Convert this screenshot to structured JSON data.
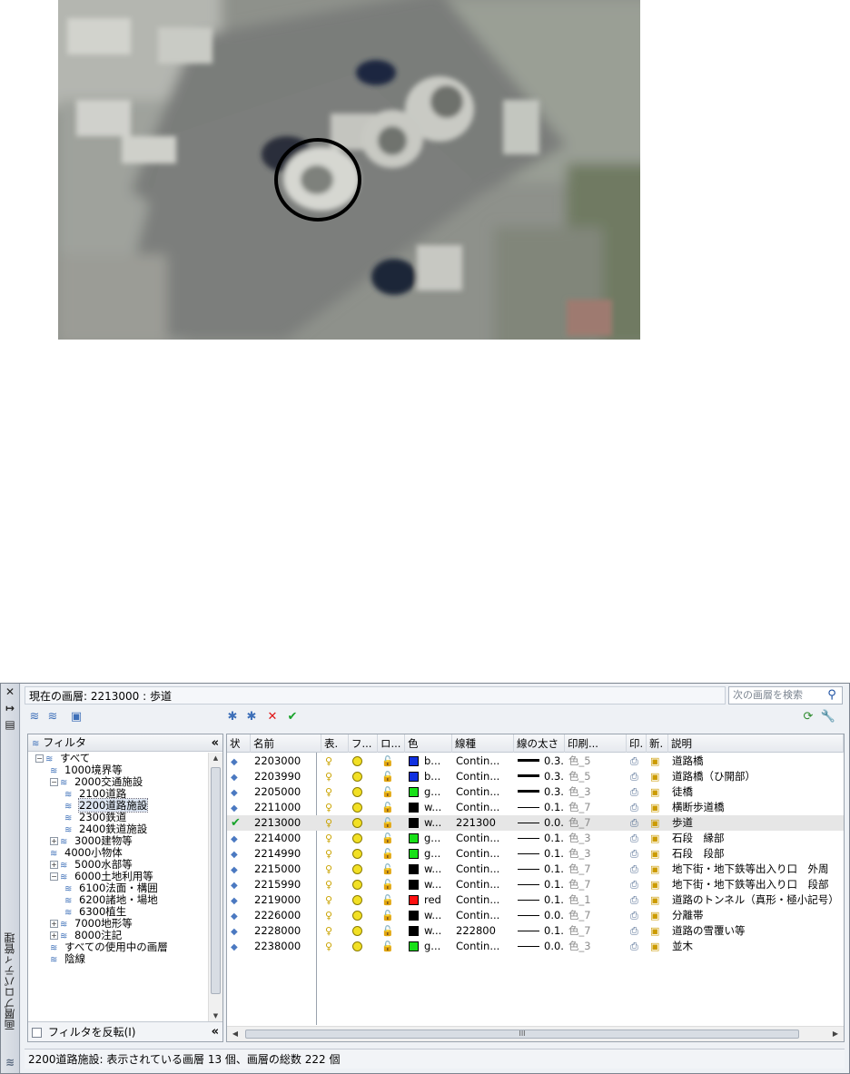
{
  "palette": {
    "title": "画層プロパティ管理",
    "current_layer": "現在の画層: 2213000 : 歩道",
    "search_placeholder": "次の画層を検索",
    "colors": {
      "accent": "#1b4fa2",
      "status_check": "#18a32a"
    }
  },
  "tree": {
    "header": "フィルタ",
    "collapse_label": "«",
    "nodes": [
      {
        "label": "すべて",
        "expander": "−"
      },
      {
        "label": "1000境界等",
        "expander": ""
      },
      {
        "label": "2000交通施設",
        "expander": "−"
      },
      {
        "label": "2100道路",
        "expander": ""
      },
      {
        "label": "2200道路施設",
        "expander": "",
        "selected": true
      },
      {
        "label": "2300鉄道",
        "expander": ""
      },
      {
        "label": "2400鉄道施設",
        "expander": ""
      },
      {
        "label": "3000建物等",
        "expander": "+"
      },
      {
        "label": "4000小物体",
        "expander": ""
      },
      {
        "label": "5000水部等",
        "expander": "+"
      },
      {
        "label": "6000土地利用等",
        "expander": "−"
      },
      {
        "label": "6100法面・構囲",
        "expander": ""
      },
      {
        "label": "6200諸地・場地",
        "expander": ""
      },
      {
        "label": "6300植生",
        "expander": ""
      },
      {
        "label": "7000地形等",
        "expander": "+"
      },
      {
        "label": "8000注記",
        "expander": "+"
      },
      {
        "label": "すべての使用中の画層",
        "expander": ""
      },
      {
        "label": "陰線",
        "expander": ""
      }
    ],
    "invert_filter_label": "フィルタを反転(I)"
  },
  "grid": {
    "columns": [
      "状",
      "名前",
      "表.",
      "フ...",
      "ロ...",
      "色",
      "線種",
      "線の太さ",
      "印刷...",
      "印.",
      "新.",
      "説明"
    ],
    "rows": [
      {
        "status": "layer",
        "name": "2203000",
        "color_name": "b...",
        "color_hex": "#1030e0",
        "linetype": "Contin...",
        "lineweight": "0.3...",
        "lw_heavy": true,
        "plot_style": "色_5",
        "description": "道路橋"
      },
      {
        "status": "layer",
        "name": "2203990",
        "color_name": "b...",
        "color_hex": "#1030e0",
        "linetype": "Contin...",
        "lineweight": "0.3...",
        "lw_heavy": true,
        "plot_style": "色_5",
        "description": "道路橋（ひ開部）"
      },
      {
        "status": "layer",
        "name": "2205000",
        "color_name": "g...",
        "color_hex": "#18e018",
        "linetype": "Contin...",
        "lineweight": "0.3...",
        "lw_heavy": true,
        "plot_style": "色_3",
        "description": "徒橋"
      },
      {
        "status": "layer",
        "name": "2211000",
        "color_name": "w...",
        "color_hex": "#000000",
        "linetype": "Contin...",
        "lineweight": "0.1...",
        "lw_heavy": false,
        "plot_style": "色_7",
        "description": "横断歩道橋"
      },
      {
        "status": "current",
        "name": "2213000",
        "color_name": "w...",
        "color_hex": "#000000",
        "linetype": "221300",
        "lineweight": "0.0...",
        "lw_heavy": false,
        "plot_style": "色_7",
        "description": "歩道"
      },
      {
        "status": "layer",
        "name": "2214000",
        "color_name": "g...",
        "color_hex": "#18e018",
        "linetype": "Contin...",
        "lineweight": "0.1...",
        "lw_heavy": false,
        "plot_style": "色_3",
        "description": "石段　縁部"
      },
      {
        "status": "layer",
        "name": "2214990",
        "color_name": "g...",
        "color_hex": "#18e018",
        "linetype": "Contin...",
        "lineweight": "0.1...",
        "lw_heavy": false,
        "plot_style": "色_3",
        "description": "石段　段部"
      },
      {
        "status": "layer",
        "name": "2215000",
        "color_name": "w...",
        "color_hex": "#000000",
        "linetype": "Contin...",
        "lineweight": "0.1...",
        "lw_heavy": false,
        "plot_style": "色_7",
        "description": "地下街・地下鉄等出入り口　外周"
      },
      {
        "status": "layer",
        "name": "2215990",
        "color_name": "w...",
        "color_hex": "#000000",
        "linetype": "Contin...",
        "lineweight": "0.1...",
        "lw_heavy": false,
        "plot_style": "色_7",
        "description": "地下街・地下鉄等出入り口　段部"
      },
      {
        "status": "layer",
        "name": "2219000",
        "color_name": "red",
        "color_hex": "#ff1010",
        "linetype": "Contin...",
        "lineweight": "0.1...",
        "lw_heavy": false,
        "plot_style": "色_1",
        "description": "道路のトンネル（真形・極小記号）"
      },
      {
        "status": "layer",
        "name": "2226000",
        "color_name": "w...",
        "color_hex": "#000000",
        "linetype": "Contin...",
        "lineweight": "0.0...",
        "lw_heavy": false,
        "plot_style": "色_7",
        "description": "分離帯"
      },
      {
        "status": "layer",
        "name": "2228000",
        "color_name": "w...",
        "color_hex": "#000000",
        "linetype": "222800",
        "lineweight": "0.1...",
        "lw_heavy": false,
        "plot_style": "色_7",
        "description": "道路の雪覆い等"
      },
      {
        "status": "layer",
        "name": "2238000",
        "color_name": "g...",
        "color_hex": "#18e018",
        "linetype": "Contin...",
        "lineweight": "0.0...",
        "lw_heavy": false,
        "plot_style": "色_3",
        "description": "並木"
      }
    ],
    "hscroll_label": "III"
  },
  "status_bar": "2200道路施設: 表示されている画層 13 個、画層の総数 222 個"
}
